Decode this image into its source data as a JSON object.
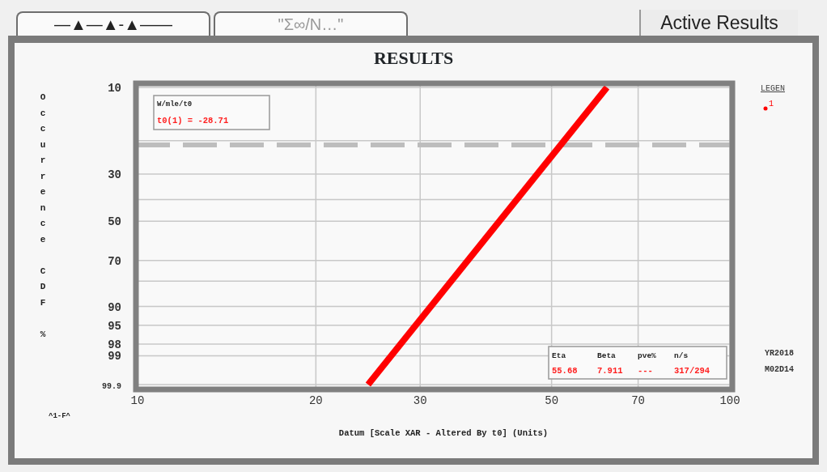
{
  "tabs": [
    {
      "label": "—▲—▲-▲——",
      "selected": false
    },
    {
      "label": "\"Σ∞/N…\"",
      "selected": false
    },
    {
      "label": "Active Results",
      "selected": true
    }
  ],
  "plot": {
    "title": "RESULTS",
    "x_axis_title": "Datum [Scale XAR - Altered By t0] (Units)",
    "y_axis_title": "Occurrence CDF %",
    "x_tick_labels": [
      "10",
      "20",
      "30",
      "50",
      "70",
      "100"
    ],
    "y_tick_labels": [
      "10",
      "30",
      "50",
      "70",
      "90",
      "95",
      "98",
      "99",
      "99.9"
    ],
    "series": [
      {
        "name": "1",
        "color": "#ff0000"
      }
    ],
    "axis_note": "^1-F^",
    "legend": {
      "title": "LEGEN"
    },
    "fit_box": {
      "header": "W/mle/t0",
      "value": "t0(1) = -28.71"
    },
    "stats_box": {
      "headers": [
        "Eta",
        "Beta",
        "pve%",
        "n/s"
      ],
      "values": [
        "55.68",
        "7.911",
        "---",
        "317/294"
      ]
    },
    "date_stamp": [
      "YR2018",
      "M02D14"
    ]
  }
}
